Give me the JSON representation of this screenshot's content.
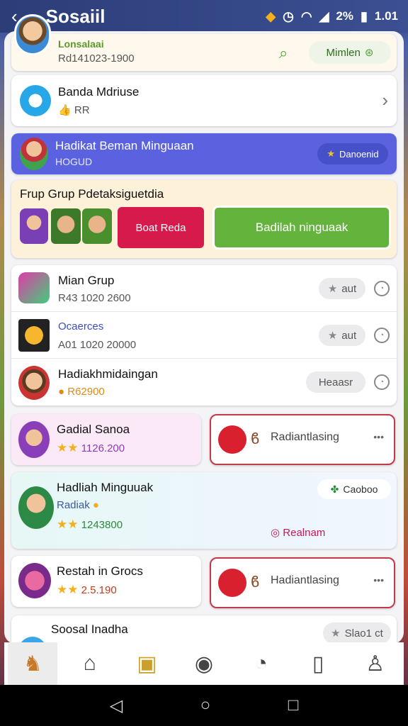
{
  "status": {
    "app_title": "Sosaiil",
    "battery": "2%",
    "time": "1.01"
  },
  "header_row": {
    "title": "Lonsalaai",
    "sub": "Rd141023-1900",
    "pill": "Mimlen"
  },
  "row2": {
    "title": "Banda Mdriuse",
    "sub": "RR"
  },
  "banner": {
    "title": "Hadikat Beman Minguaan",
    "sub": "HOGUD",
    "badge": "Danoenid"
  },
  "group": {
    "title": "Frup Grup Pdetaksiguetdia",
    "btn_red": "Boat Reda",
    "btn_green": "Badilah ninguaak"
  },
  "list": [
    {
      "title": "Mian Grup",
      "sub": "R43 1020 2600",
      "pill": "aut"
    },
    {
      "title": "Ocaerces",
      "sub": "A01 1020 20000",
      "pill": "aut"
    },
    {
      "title": "Hadiakhmidaingan",
      "sub": "R62900",
      "pill": "Heaasr"
    }
  ],
  "gadial": {
    "title": "Gadial Sanoa",
    "value": "1126.200",
    "right": "Radiantlasing"
  },
  "hadiah": {
    "title": "Hadliah Minguuak",
    "sub": "Radiak",
    "value": "1243800",
    "badge": "Caoboo",
    "link": "Realnam"
  },
  "restah": {
    "title": "Restah in Grocs",
    "value": "2.5.190",
    "right": "Hadiantlasing"
  },
  "social": {
    "title": "Soosal Inadha",
    "pill": "Slao1 ct"
  },
  "colors": {
    "banner": "#5a62e0",
    "green": "#63b33d",
    "red": "#d61a4b"
  },
  "nav_icons": [
    "badge-icon",
    "home-icon",
    "shop-icon",
    "compass-icon",
    "timer-icon",
    "bag-icon",
    "profile-icon"
  ],
  "sys_icons": [
    "back-icon",
    "home-circle-icon",
    "recents-icon"
  ]
}
